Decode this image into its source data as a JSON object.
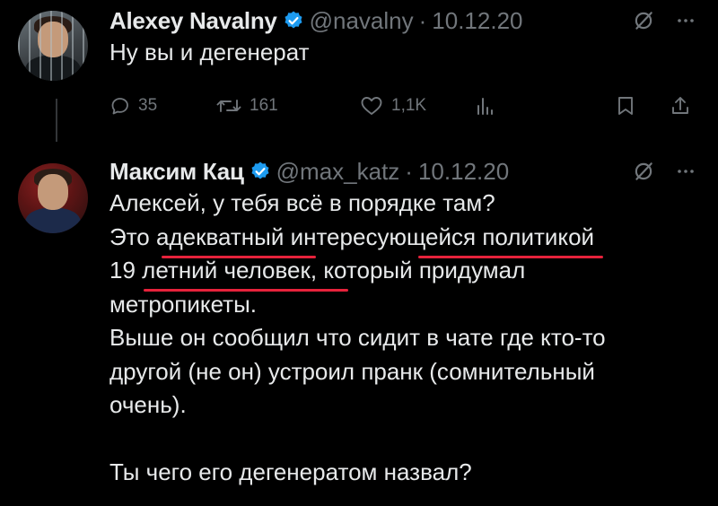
{
  "tweet1": {
    "name": "Alexey Navalny",
    "handle": "@navalny",
    "dot": "·",
    "date": "10.12.20",
    "text": "Ну вы и дегенерат",
    "replies": "35",
    "retweets": "161",
    "likes": "1,1K"
  },
  "tweet2": {
    "name": "Максим Кац",
    "handle": "@max_katz",
    "dot": "·",
    "date": "10.12.20",
    "lines": [
      "Алексей, у тебя всё в порядке там?",
      "Это адекватный интересующейся политикой",
      "19 летний человек, который придумал",
      "метропикеты.",
      "Выше он сообщил что сидит в чате где кто-то",
      "другой (не он) устроил пранк (сомнительный",
      "очень).",
      "",
      "Ты чего его дегенератом назвал?"
    ]
  },
  "colors": {
    "background": "#000000",
    "text": "#e7e9ea",
    "muted": "#71767b",
    "verified": "#1d9bf0",
    "underline": "#e6223b"
  },
  "icons": [
    "verified-badge-icon",
    "grok-icon",
    "more-icon",
    "reply-icon",
    "retweet-icon",
    "like-icon",
    "views-icon",
    "bookmark-icon",
    "share-icon"
  ]
}
